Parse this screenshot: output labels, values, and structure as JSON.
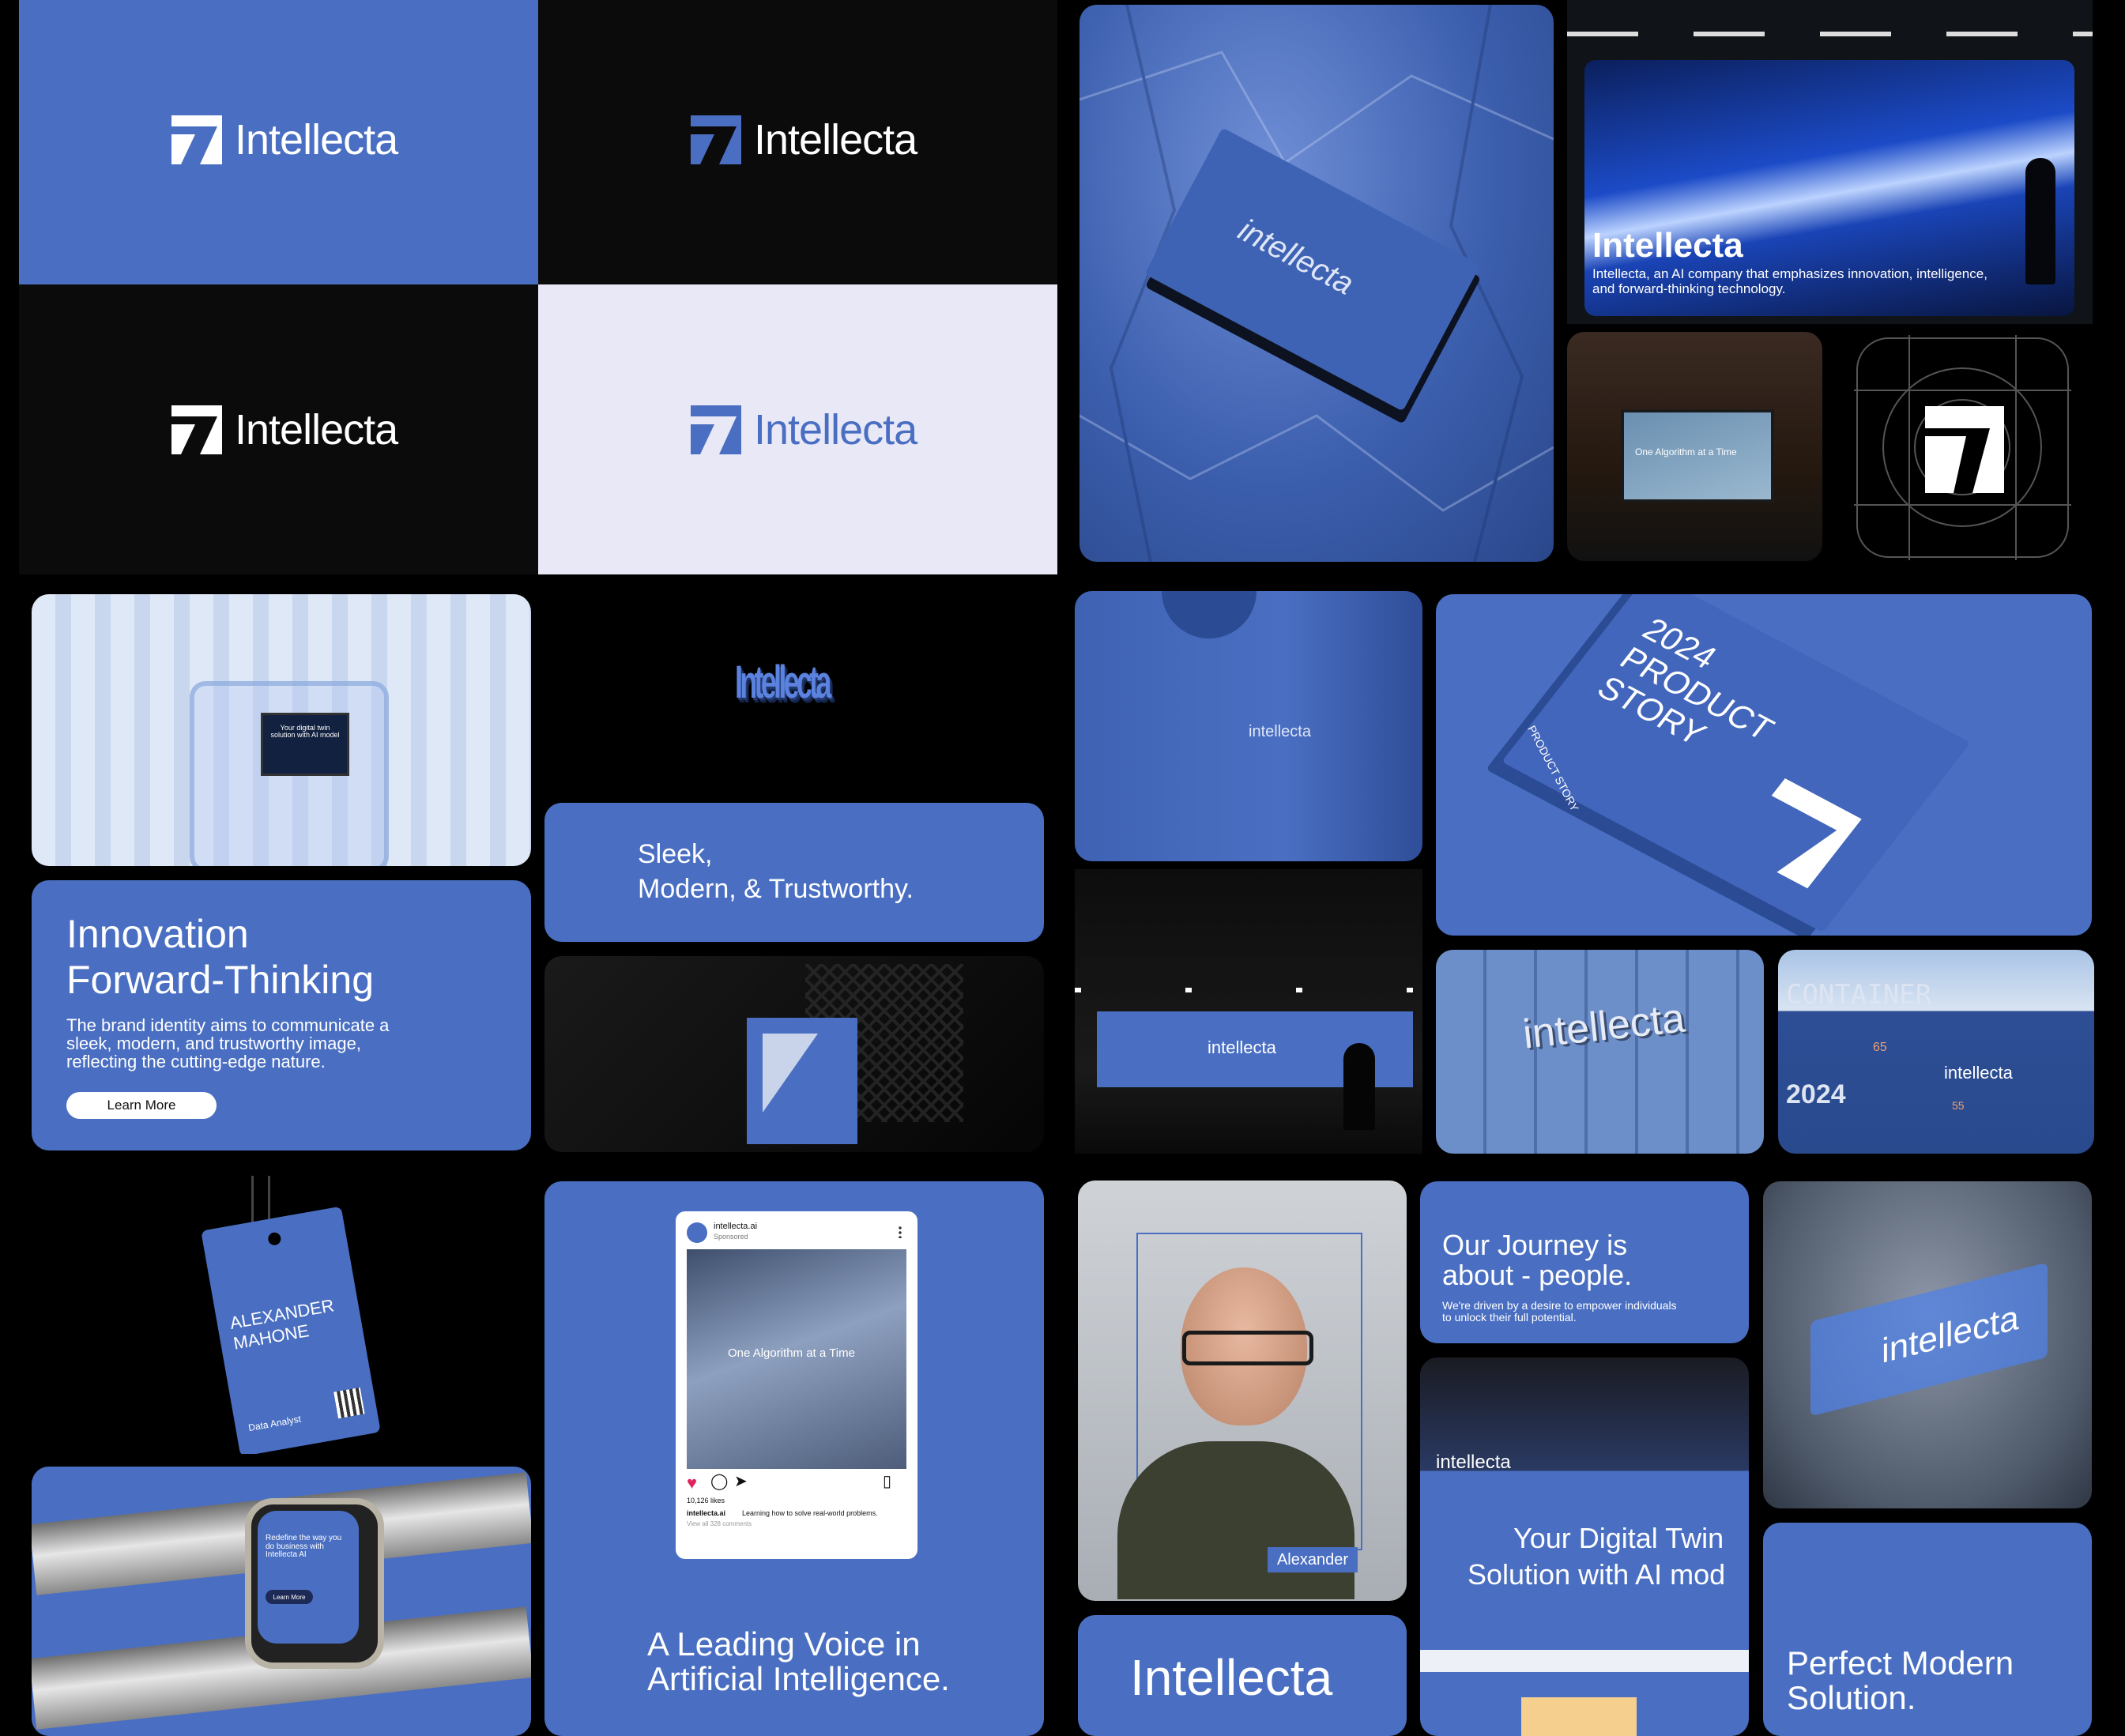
{
  "brand": "Intellecta",
  "brand_lower": "intellecta",
  "colors": {
    "brand_blue": "#4a6fc2",
    "black": "#0b0b0b",
    "light": "#e8e8f6",
    "white": "#ffffff"
  },
  "hero_billboard": {
    "title": "Intellecta",
    "description": "Intellecta, an AI company that emphasizes innovation, intelligence, and forward-thinking technology."
  },
  "street_billboard_caption": "One Algorithm at a Time",
  "laptop_screen_text": "Your digital twin solution with AI model",
  "tagline_card": {
    "line1": "Sleek,",
    "line2": "Modern, & Trustworthy."
  },
  "innovation_card": {
    "title_line1": "Innovation",
    "title_line2": "Forward-Thinking",
    "body": "The brand identity aims to communicate a sleek, modern, and trustworthy image, reflecting the cutting-edge nature.",
    "button": "Learn More"
  },
  "book": {
    "title_line1": "2024",
    "title_line2": "PRODUCT",
    "title_line3": "STORY",
    "spine": "PRODUCT STORY"
  },
  "container": {
    "label": "CONTAINER",
    "year": "2024",
    "mark1": "65",
    "mark2": "55"
  },
  "badge": {
    "first": "ALEXANDER",
    "last": "MAHONE",
    "footer": "Data Analyst"
  },
  "instagram": {
    "handle": "intellecta.ai",
    "sub": "Sponsored",
    "post_title": "One Algorithm at a Time",
    "likes": "10,126 likes",
    "caption_user": "intellecta.ai",
    "caption": "Learning how to solve real-world problems.",
    "comments": "View all 328 comments"
  },
  "leading_voice": {
    "line1": "A Leading Voice in",
    "line2": "Artificial Intelligence."
  },
  "portrait_name": "Alexander",
  "journey_card": {
    "title_line1": "Our Journey is",
    "title_line2": "about - people.",
    "body": "We're driven by a desire to empower individuals to unlock their full potential."
  },
  "digital_twin": {
    "line1": "Your Digital Twin",
    "line2": "Solution with AI mod"
  },
  "big_word": "Intellecta",
  "perfect_card": {
    "line1": "Perfect Modern",
    "line2": "Solution."
  },
  "watch": {
    "title": "Redefine the way you do business with Intellecta AI",
    "button": "Learn More"
  }
}
